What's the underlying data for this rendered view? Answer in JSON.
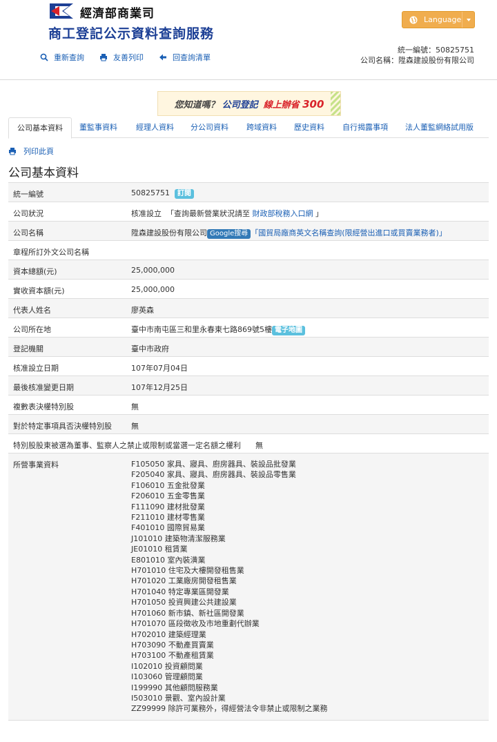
{
  "header": {
    "org_name": "經濟部商業司",
    "service_name": "商工登記公示資料查詢服務",
    "toolbar": [
      {
        "label": "重新查詢",
        "icon": "search-icon"
      },
      {
        "label": "友善列印",
        "icon": "print-icon"
      },
      {
        "label": "回查詢清單",
        "icon": "arrow-left-icon"
      }
    ],
    "language_label": "Language",
    "corp_id_line": "統一編號：50825751",
    "corp_name_line": "公司名稱：陞森建設股份有限公司"
  },
  "banner": {
    "part1": "您知道嗎？",
    "part2": "公司登記",
    "part3": "線上辦省",
    "part4": "300"
  },
  "tabs": [
    "公司基本資料",
    "董監事資料",
    "經理人資料",
    "分公司資料",
    "跨域資料",
    "歷史資料",
    "自行揭露事項",
    "法人董監網絡試用版"
  ],
  "print_label": "列印此頁",
  "section_title": "公司基本資料",
  "rows": {
    "uid": {
      "label": "統一編號",
      "value": "50825751",
      "badge": "訂閱"
    },
    "status": {
      "label": "公司狀況",
      "value": "核准設立",
      "prefix": "「查詢最新營業狀況請至",
      "link": "財政部稅務入口網",
      "suffix": "」"
    },
    "name": {
      "label": "公司名稱",
      "value": "陞森建設股份有限公司",
      "badge": "Google搜尋",
      "link": "「國貿局廠商英文名稱查詢(限經營出進口或買賣業務者)」"
    },
    "foreign_name": {
      "label": "章程所訂外文公司名稱",
      "value": ""
    },
    "capital_total": {
      "label": "資本總額(元)",
      "value": "25,000,000"
    },
    "capital_paid": {
      "label": "實收資本額(元)",
      "value": "25,000,000"
    },
    "rep": {
      "label": "代表人姓名",
      "value": "廖英森"
    },
    "address": {
      "label": "公司所在地",
      "value": "臺中市南屯區三和里永春東七路869號5樓",
      "badge": "電子地圖"
    },
    "authority": {
      "label": "登記機關",
      "value": "臺中市政府"
    },
    "setup_date": {
      "label": "核准設立日期",
      "value": "107年07月04日"
    },
    "change_date": {
      "label": "最後核准變更日期",
      "value": "107年12月25日"
    },
    "multi_vote": {
      "label": "複數表決權特別股",
      "value": "無"
    },
    "veto": {
      "label": "對於特定事項具否決權特別股",
      "value": "無"
    },
    "special": {
      "label": "特別股股東被選為董事、監察人之禁止或限制或當選一定名額之權利",
      "value": "無"
    },
    "business": {
      "label": "所營事業資料",
      "items": [
        "F105050 家具、寢具、廚房器具、裝設品批發業",
        "F205040 家具、寢具、廚房器具、裝設品零售業",
        "F106010 五金批發業",
        "F206010 五金零售業",
        "F111090 建材批發業",
        "F211010 建材零售業",
        "F401010 國際貿易業",
        "J101010 建築物清潔服務業",
        "JE01010 租賃業",
        "E801010 室內裝潢業",
        "H701010 住宅及大樓開發租售業",
        "H701020 工業廠房開發租售業",
        "H701040 特定專業區開發業",
        "H701050 投資興建公共建設業",
        "H701060 新市鎮、新社區開發業",
        "H701070 區段徵收及市地重劃代辦業",
        "H702010 建築經理業",
        "H703090 不動產買賣業",
        "H703100 不動產租賃業",
        "I102010 投資顧問業",
        "I103060 管理顧問業",
        "I199990 其他顧問服務業",
        "I503010 景觀、室內設計業",
        "ZZ99999 除許可業務外，得經營法令非禁止或限制之業務"
      ]
    }
  }
}
